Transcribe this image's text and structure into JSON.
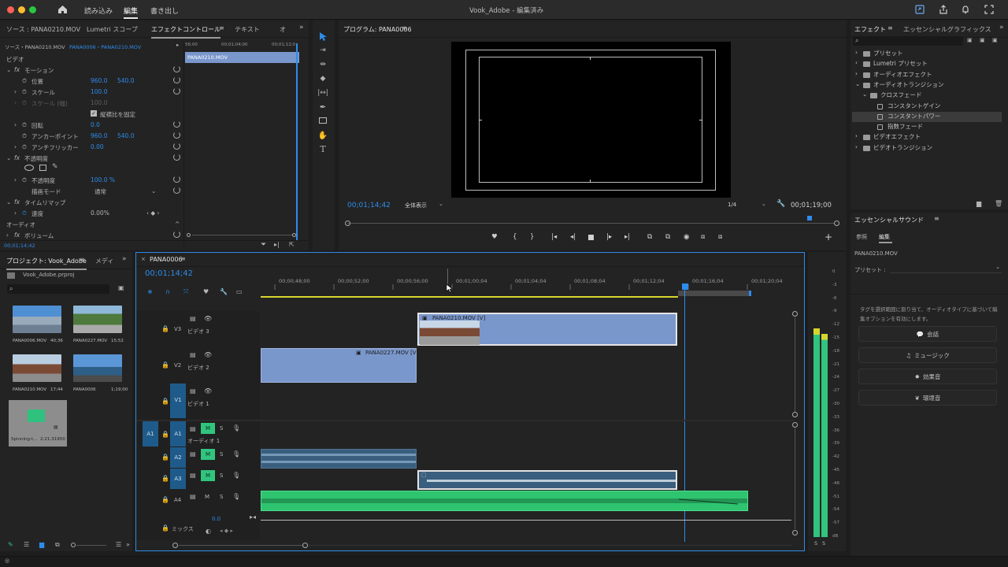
{
  "topbar": {
    "title": "Vook_Adobe - 編集済み",
    "nav": [
      "読み込み",
      "編集",
      "書き出し"
    ]
  },
  "effect_controls": {
    "tabs": [
      "ソース : PANA0210.MOV",
      "Lumetri スコープ",
      "エフェクトコントロール",
      "テキスト",
      "オ"
    ],
    "source": "ソース・PANA0210.MOV",
    "seq": "PANA0006・PANA0210.MOV",
    "ruler": [
      "56;00",
      "00;01;04;00",
      "00;01;12;0"
    ],
    "clip": "PANA0210.MOV",
    "section_video": "ビデオ",
    "motion": "モーション",
    "position": "位置",
    "position_x": "960.0",
    "position_y": "540.0",
    "scale": "スケール",
    "scale_val": "100.0",
    "scale_w": "スケール (幅)",
    "scale_w_val": "100.0",
    "uniform": "縦横比を固定",
    "rotation": "回転",
    "rotation_val": "0.0",
    "anchor": "アンカーポイント",
    "anchor_x": "960.0",
    "anchor_y": "540.0",
    "flicker": "アンチフリッカー",
    "flicker_val": "0.00",
    "opacity_group": "不透明度",
    "opacity": "不透明度",
    "opacity_val": "100.0 %",
    "blend": "描画モード",
    "blend_val": "通常",
    "time_remap": "タイムリマップ",
    "speed": "速度",
    "speed_val": "0.00%",
    "section_audio": "オーディオ",
    "volume": "ボリューム",
    "time": "00;01;14;42"
  },
  "program": {
    "title": "プログラム: PANA0006",
    "timecode": "00;01;14;42",
    "fit": "全体表示",
    "quality": "1/4",
    "duration": "00;01;19;00"
  },
  "effects": {
    "tabs": [
      "エフェクト",
      "エッセンシャルグラフィックス"
    ],
    "items": [
      {
        "label": "プリセット",
        "level": 0
      },
      {
        "label": "Lumetri プリセット",
        "level": 0
      },
      {
        "label": "オーディオエフェクト",
        "level": 0
      },
      {
        "label": "オーディオトランジション",
        "level": 0
      },
      {
        "label": "クロスフェード",
        "level": 1
      },
      {
        "label": "コンスタントゲイン",
        "level": 2
      },
      {
        "label": "コンスタントパワー",
        "level": 2
      },
      {
        "label": "指数フェード",
        "level": 2
      },
      {
        "label": "ビデオエフェクト",
        "level": 0
      },
      {
        "label": "ビデオトランジション",
        "level": 0
      }
    ]
  },
  "essential_sound": {
    "title": "エッセンシャルサウンド",
    "tabs": [
      "参照",
      "編集"
    ],
    "clip": "PANA0210.MOV",
    "preset": "プリセット :",
    "hint": "タグを選択範囲に割り当て、オーディオタイプに基づいて編集オプションを有効にします。",
    "buttons": [
      "会話",
      "ミュージック",
      "効果音",
      "環境音"
    ]
  },
  "project": {
    "tabs": [
      "プロジェクト: Vook_Adobe",
      "メディ"
    ],
    "file": "Vook_Adobe.prproj",
    "items": [
      {
        "name": "PANA0006.MOV",
        "dur": "40;36"
      },
      {
        "name": "PANA0227.MOV",
        "dur": "15;52"
      },
      {
        "name": "PANA0210.MOV",
        "dur": "17;44"
      },
      {
        "name": "PANA0006",
        "dur": "1;19;00"
      },
      {
        "name": "Spinning-t...",
        "dur": "2:21:31950"
      }
    ]
  },
  "timeline": {
    "tab": "PANA0006",
    "timecode": "00;01;14;42",
    "ruler": [
      "00;00;48;00",
      "00;00;52;00",
      "00;00;56;00",
      "00;01;00;04",
      "00;01;04;04",
      "00;01;08;04",
      "00;01;12;04",
      "00;01;16;04",
      "00;01;20;04"
    ],
    "tracks": {
      "v3": "V3",
      "v3name": "ビデオ 3",
      "v2": "V2",
      "v2name": "ビデオ 2",
      "v1": "V1",
      "v1name": "ビデオ 1",
      "a1": "A1",
      "a1name": "オーディオ 1",
      "a2": "A2",
      "a3": "A3",
      "a4": "A4",
      "mix": "ミックス",
      "mixval": "0.0"
    },
    "clips": {
      "v3": "PANA0210.MOV [V]",
      "v2": "PANA0227.MOV [V]"
    }
  },
  "meters": [
    "0",
    "-3",
    "-6",
    "-9",
    "-12",
    "-15",
    "-18",
    "-21",
    "-24",
    "-27",
    "-30",
    "-33",
    "-36",
    "-39",
    "-42",
    "-45",
    "-48",
    "-51",
    "-54",
    "-57",
    "dB"
  ],
  "colors": {
    "accent": "#2d8ceb",
    "audio_green": "#31c47e",
    "video_clip": "#7a97cc",
    "track_active": "#1f5b8a"
  }
}
